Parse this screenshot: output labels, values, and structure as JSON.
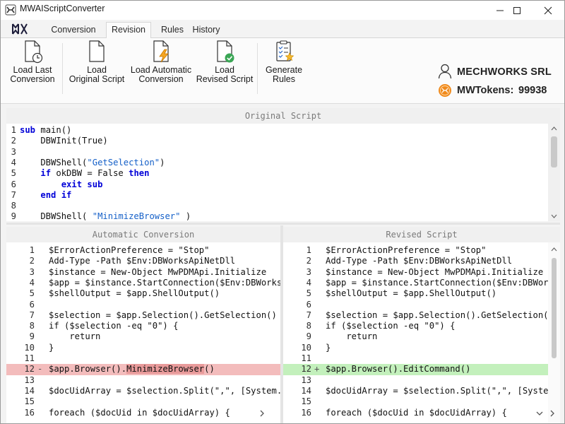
{
  "app": {
    "title": "MWAIScriptConverter"
  },
  "tabs": [
    {
      "label": "Conversion"
    },
    {
      "label": "Revision"
    },
    {
      "label": "Rules"
    },
    {
      "label": "History"
    }
  ],
  "ribbon": {
    "buttons": [
      {
        "label_line1": "Load Last",
        "label_line2": "Conversion",
        "icon": "document-clock-icon"
      },
      {
        "label_line1": "Load",
        "label_line2": "Original Script",
        "icon": "document-icon"
      },
      {
        "label_line1": "Load Automatic",
        "label_line2": "Conversion",
        "icon": "document-lightning-icon"
      },
      {
        "label_line1": "Load",
        "label_line2": "Revised Script",
        "icon": "document-check-icon"
      },
      {
        "label_line1": "Generate",
        "label_line2": "Rules",
        "icon": "checklist-star-icon"
      }
    ]
  },
  "account": {
    "company": "MECHWORKS SRL",
    "tokens_label": "MWTokens:",
    "tokens_value": "99938"
  },
  "original": {
    "header": "Original Script",
    "lines": [
      {
        "n": "1",
        "t": "sub main()"
      },
      {
        "n": "2",
        "t": "    DBWInit(True)"
      },
      {
        "n": "3",
        "t": ""
      },
      {
        "n": "4",
        "t": "    DBWShell(\"GetSelection\")"
      },
      {
        "n": "5",
        "t": "    if okDBW = False then"
      },
      {
        "n": "6",
        "t": "        exit sub"
      },
      {
        "n": "7",
        "t": "    end if"
      },
      {
        "n": "8",
        "t": ""
      },
      {
        "n": "9",
        "t": "    DBWShell( \"MinimizeBrowser\" )"
      }
    ]
  },
  "automatic": {
    "header": "Automatic Conversion",
    "lines": [
      {
        "n": "1",
        "m": "",
        "t": "$ErrorActionPreference = \"Stop\""
      },
      {
        "n": "2",
        "m": "",
        "t": "Add-Type -Path $Env:DBWorksApiNetDll"
      },
      {
        "n": "3",
        "m": "",
        "t": "$instance = New-Object MwPDMApi.Initialize"
      },
      {
        "n": "4",
        "m": "",
        "t": "$app = $instance.StartConnection($Env:DBWorksApi"
      },
      {
        "n": "5",
        "m": "",
        "t": "$shellOutput = $app.ShellOutput()"
      },
      {
        "n": "6",
        "m": "",
        "t": ""
      },
      {
        "n": "7",
        "m": "",
        "t": "$selection = $app.Selection().GetSelection()"
      },
      {
        "n": "8",
        "m": "",
        "t": "if ($selection -eq \"0\") {"
      },
      {
        "n": "9",
        "m": "",
        "t": "    return"
      },
      {
        "n": "10",
        "m": "",
        "t": "}"
      },
      {
        "n": "11",
        "m": "",
        "t": ""
      },
      {
        "n": "12",
        "m": "-",
        "t": "$app.Browser().MinimizeBrowser()"
      },
      {
        "n": "13",
        "m": "",
        "t": ""
      },
      {
        "n": "14",
        "m": "",
        "t": "$docUidArray = $selection.Split(\",\", [System.St"
      },
      {
        "n": "15",
        "m": "",
        "t": ""
      },
      {
        "n": "16",
        "m": "",
        "t": "foreach ($docUid in $docUidArray) {"
      }
    ]
  },
  "revised": {
    "header": "Revised Script",
    "lines": [
      {
        "n": "1",
        "m": "",
        "t": "$ErrorActionPreference = \"Stop\""
      },
      {
        "n": "2",
        "m": "",
        "t": "Add-Type -Path $Env:DBWorksApiNetDll"
      },
      {
        "n": "3",
        "m": "",
        "t": "$instance = New-Object MwPDMApi.Initialize"
      },
      {
        "n": "4",
        "m": "",
        "t": "$app = $instance.StartConnection($Env:DBWorksAp"
      },
      {
        "n": "5",
        "m": "",
        "t": "$shellOutput = $app.ShellOutput()"
      },
      {
        "n": "6",
        "m": "",
        "t": ""
      },
      {
        "n": "7",
        "m": "",
        "t": "$selection = $app.Selection().GetSelection()"
      },
      {
        "n": "8",
        "m": "",
        "t": "if ($selection -eq \"0\") {"
      },
      {
        "n": "9",
        "m": "",
        "t": "    return"
      },
      {
        "n": "10",
        "m": "",
        "t": "}"
      },
      {
        "n": "11",
        "m": "",
        "t": ""
      },
      {
        "n": "12",
        "m": "+",
        "t": "$app.Browser().EditCommand()"
      },
      {
        "n": "13",
        "m": "",
        "t": ""
      },
      {
        "n": "14",
        "m": "",
        "t": "$docUidArray = $selection.Split(\",\", [System.St"
      },
      {
        "n": "15",
        "m": "",
        "t": ""
      },
      {
        "n": "16",
        "m": "",
        "t": "foreach ($docUid in $docUidArray) {"
      }
    ]
  },
  "colors": {
    "removed": "#f3bcbc",
    "added": "#c3f0bc",
    "removed_strong": "#e89a9a",
    "keyword": "#0000d8",
    "string": "#1560c8",
    "token_orange": "#f08a1c"
  }
}
